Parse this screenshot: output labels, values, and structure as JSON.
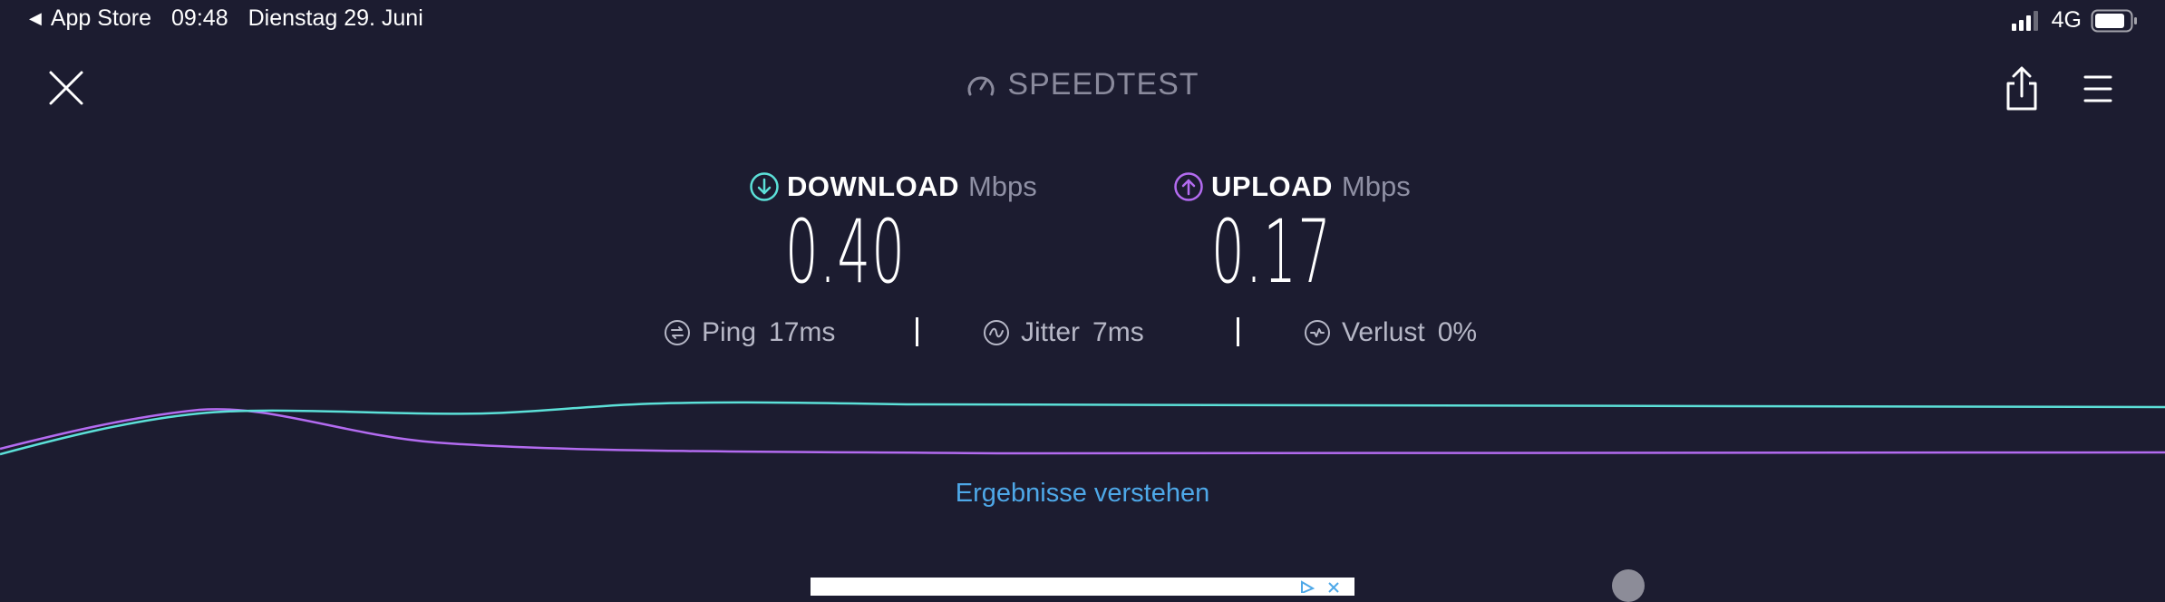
{
  "status_bar": {
    "back_label": "App Store",
    "time": "09:48",
    "date": "Dienstag 29. Juni",
    "network": "4G",
    "icons": [
      "back-arrow-icon",
      "signal-icon",
      "battery-icon"
    ]
  },
  "header": {
    "logo_text": "SPEEDTEST",
    "icons": [
      "close-icon",
      "speedtest-logo-icon",
      "share-icon",
      "menu-icon"
    ]
  },
  "download": {
    "label": "DOWNLOAD",
    "unit": "Mbps",
    "value": "0.40",
    "color": "#5ce0d8"
  },
  "upload": {
    "label": "UPLOAD",
    "unit": "Mbps",
    "value": "0.17",
    "color": "#b36bf0"
  },
  "stats": {
    "ping": {
      "label": "Ping",
      "value": "17ms"
    },
    "jitter": {
      "label": "Jitter",
      "value": "7ms"
    },
    "loss": {
      "label": "Verlust",
      "value": "0%"
    }
  },
  "link": {
    "label": "Ergebnisse verstehen",
    "color": "#4ea8e8"
  },
  "colors": {
    "background": "#1c1c30",
    "muted_text": "#8f90a4"
  }
}
